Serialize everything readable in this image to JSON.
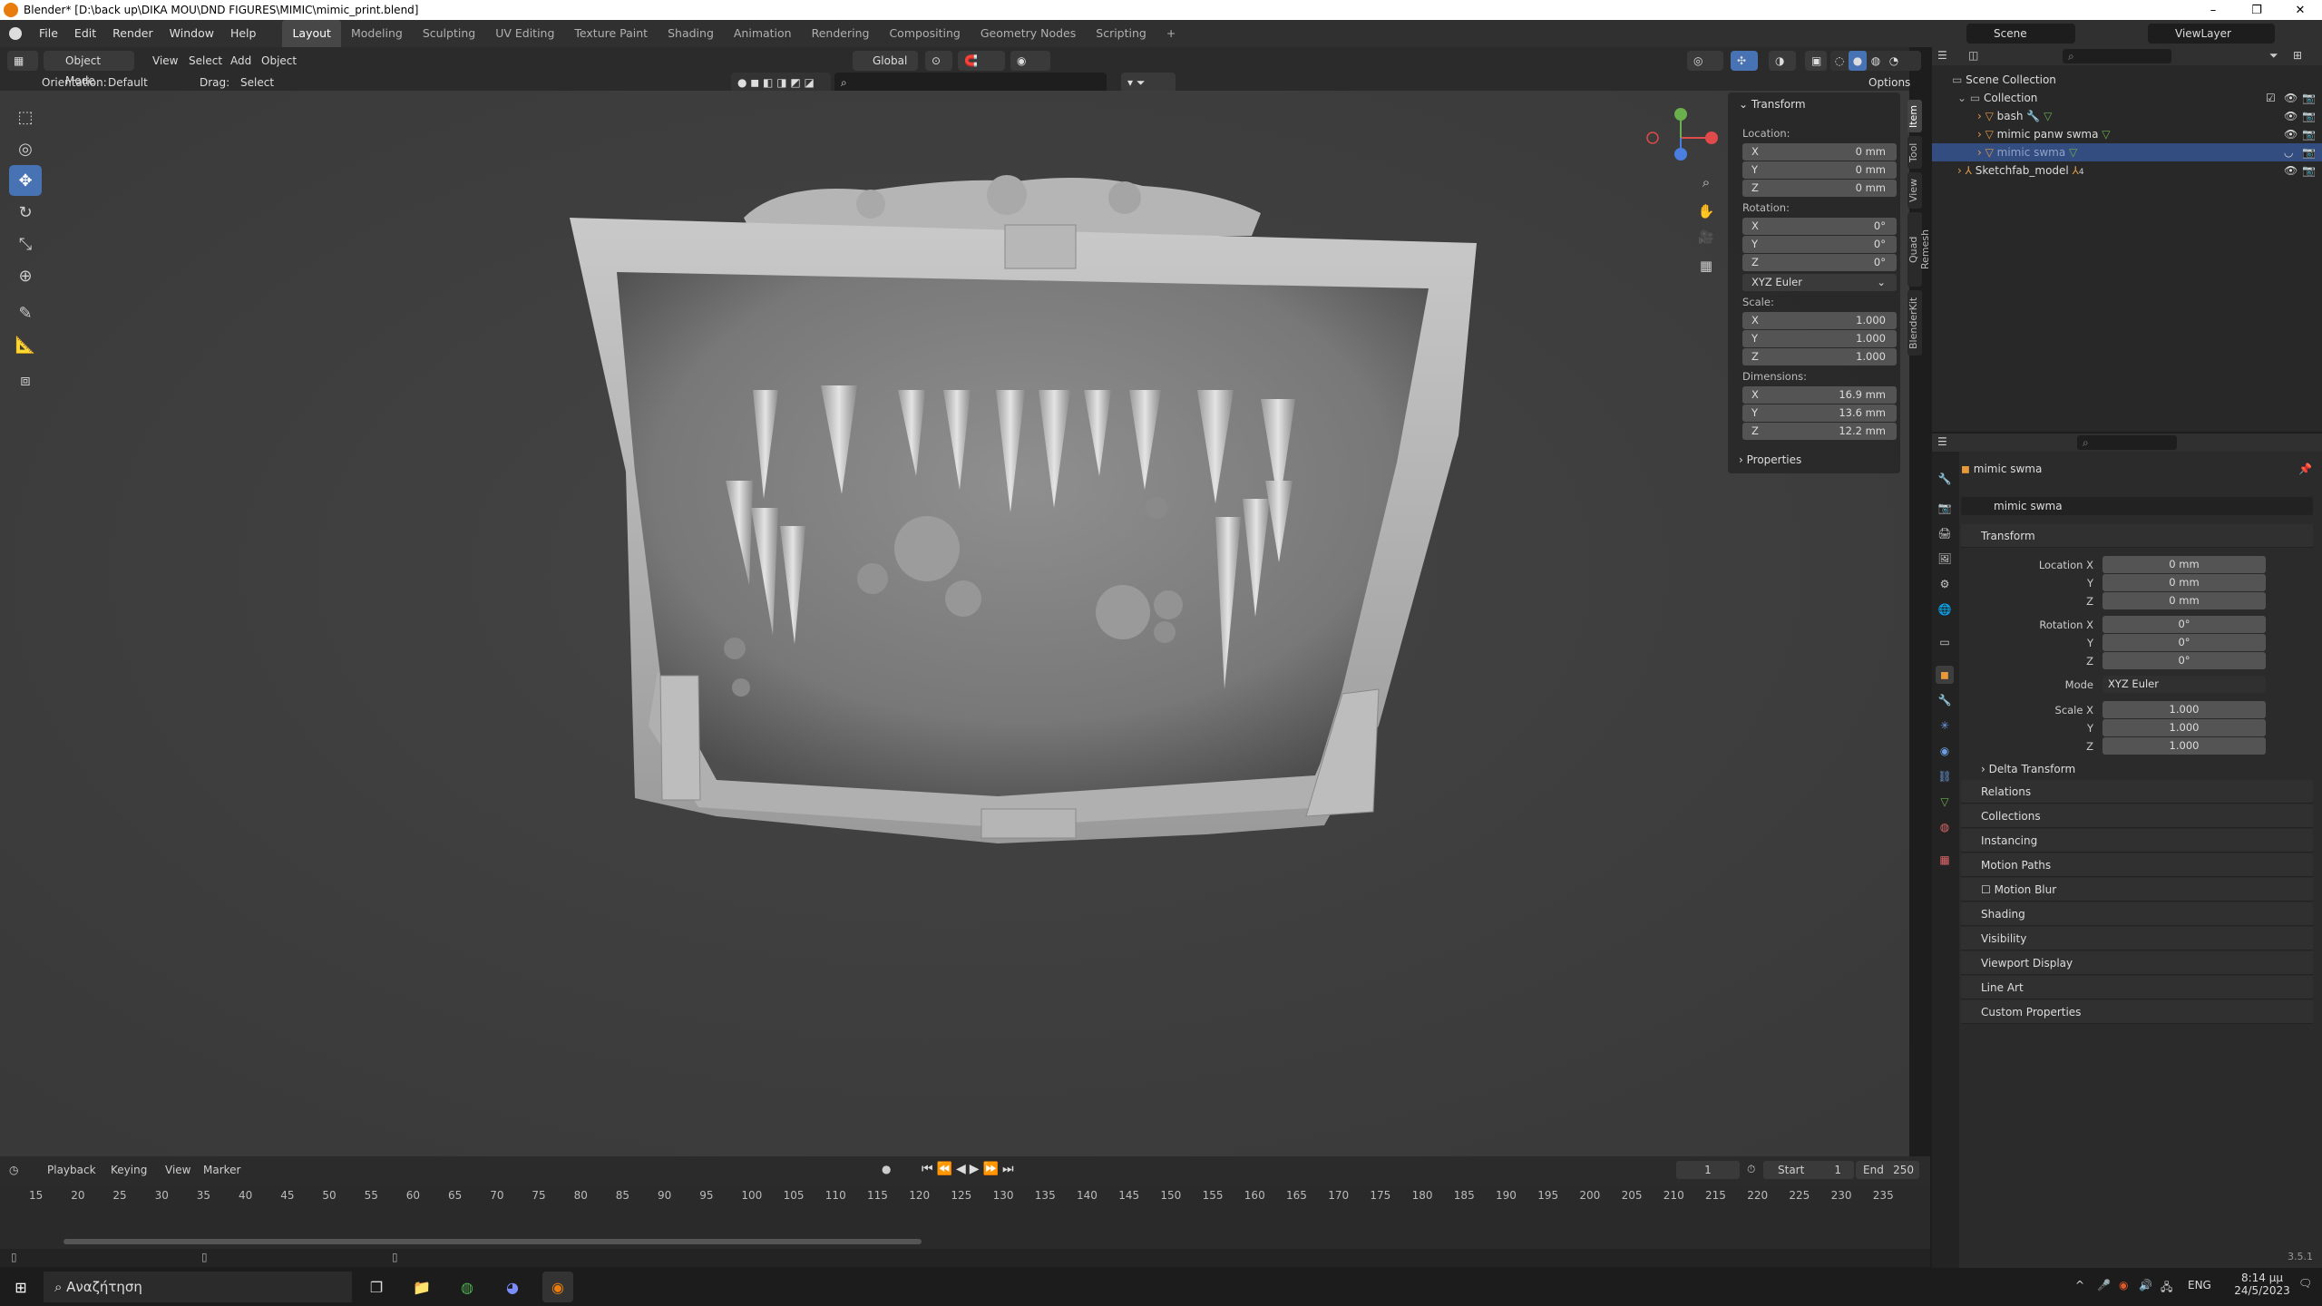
{
  "window": {
    "title": "Blender* [D:\\back up\\DIKA MOU\\DND FIGURES\\MIMIC\\mimic_print.blend]",
    "controls": [
      "–",
      "❐",
      "✕"
    ]
  },
  "menubar": {
    "items": [
      "File",
      "Edit",
      "Render",
      "Window",
      "Help"
    ],
    "workspaces": [
      "Layout",
      "Modeling",
      "Sculpting",
      "UV Editing",
      "Texture Paint",
      "Shading",
      "Animation",
      "Rendering",
      "Compositing",
      "Geometry Nodes",
      "Scripting",
      "+"
    ],
    "active_workspace": "Layout",
    "scene_label": "Scene",
    "viewlayer_label": "ViewLayer"
  },
  "viewport_header": {
    "mode": "Object Mode",
    "menus": [
      "View",
      "Select",
      "Add",
      "Object"
    ],
    "transform_orientation": "Global",
    "orientation_label": "Orientation:",
    "orientation_value": "Default",
    "drag_label": "Drag:",
    "drag_value": "Select Box",
    "options_label": "Options"
  },
  "toolbar": {
    "tools": [
      "select-box-icon",
      "cursor-icon",
      "move-icon",
      "rotate-icon",
      "scale-icon",
      "transform-icon",
      "annotate-icon",
      "measure-icon",
      "add-cube-icon"
    ],
    "active_tool": "move-icon"
  },
  "npanel": {
    "header": "Transform",
    "location_label": "Location:",
    "location": [
      {
        "axis": "X",
        "value": "0 mm"
      },
      {
        "axis": "Y",
        "value": "0 mm"
      },
      {
        "axis": "Z",
        "value": "0 mm"
      }
    ],
    "rotation_label": "Rotation:",
    "rotation": [
      {
        "axis": "X",
        "value": "0°"
      },
      {
        "axis": "Y",
        "value": "0°"
      },
      {
        "axis": "Z",
        "value": "0°"
      }
    ],
    "rotation_mode": "XYZ Euler",
    "scale_label": "Scale:",
    "scale": [
      {
        "axis": "X",
        "value": "1.000"
      },
      {
        "axis": "Y",
        "value": "1.000"
      },
      {
        "axis": "Z",
        "value": "1.000"
      }
    ],
    "dimensions_label": "Dimensions:",
    "dimensions": [
      {
        "axis": "X",
        "value": "16.9 mm"
      },
      {
        "axis": "Y",
        "value": "13.6 mm"
      },
      {
        "axis": "Z",
        "value": "12.2 mm"
      }
    ],
    "properties_label": "Properties",
    "tabs": [
      "Item",
      "Tool",
      "View",
      "Quad Remesh",
      "BlenderKit"
    ],
    "active_tab": "Item"
  },
  "outliner": {
    "root": "Scene Collection",
    "rows": [
      {
        "name": "Collection",
        "indent": 1,
        "selected": false
      },
      {
        "name": "bash",
        "indent": 2,
        "selected": false
      },
      {
        "name": "mimic panw swma",
        "indent": 2,
        "selected": false
      },
      {
        "name": "mimic swma",
        "indent": 2,
        "selected": true
      },
      {
        "name": "Sketchfab_model",
        "indent": 1,
        "selected": false
      }
    ],
    "sketchfab_count": "4"
  },
  "properties": {
    "object_name": "mimic swma",
    "data_name": "mimic swma",
    "transform_header": "Transform",
    "location_x_label": "Location X",
    "location": [
      "0 mm",
      "0 mm",
      "0 mm"
    ],
    "rotation_x_label": "Rotation X",
    "rotation": [
      "0°",
      "0°",
      "0°"
    ],
    "mode_label": "Mode",
    "mode_value": "XYZ Euler",
    "scale_x_label": "Scale X",
    "scale": [
      "1.000",
      "1.000",
      "1.000"
    ],
    "axis_y": "Y",
    "axis_z": "Z",
    "delta_transform": "Delta Transform",
    "sections": [
      "Relations",
      "Collections",
      "Instancing",
      "Motion Paths",
      "Motion Blur",
      "Shading",
      "Visibility",
      "Viewport Display",
      "Line Art",
      "Custom Properties"
    ]
  },
  "timeline": {
    "menus": [
      "Playback",
      "Keying",
      "View",
      "Marker"
    ],
    "current_frame": "1",
    "start_label": "Start",
    "start": "1",
    "end_label": "End",
    "end": "250",
    "ticks": [
      "15",
      "20",
      "25",
      "30",
      "35",
      "40",
      "45",
      "50",
      "55",
      "60",
      "65",
      "70",
      "75",
      "80",
      "85",
      "90",
      "95",
      "100",
      "105",
      "110",
      "115",
      "120",
      "125",
      "130",
      "135",
      "140",
      "145",
      "150",
      "155",
      "160",
      "165",
      "170",
      "175",
      "180",
      "185",
      "190",
      "195",
      "200",
      "205",
      "210",
      "215",
      "220",
      "225",
      "230",
      "235"
    ]
  },
  "statusbar": {
    "version": "3.5.1"
  },
  "taskbar": {
    "search_placeholder": "Αναζήτηση",
    "lang": "ENG",
    "time": "8:14 μμ",
    "date": "24/5/2023"
  },
  "colors": {
    "accent": "#4772b3",
    "selected_row": "#334d80",
    "axis_x": "#e04a4a",
    "axis_y": "#6ab04c",
    "axis_z": "#4a7ee0"
  }
}
